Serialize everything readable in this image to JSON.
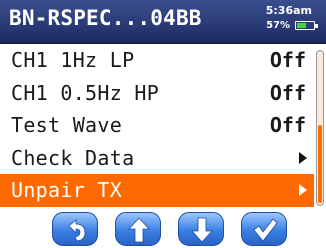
{
  "header": {
    "title": "BN-RSPEC...04BB",
    "time": "5:36am",
    "battery_percent": "57%",
    "battery_level": 0.57,
    "battery_color": "#46d23a"
  },
  "menu": {
    "items": [
      {
        "label": "CH1 1Hz LP",
        "value": "Off"
      },
      {
        "label": "CH1 0.5Hz HP",
        "value": "Off"
      },
      {
        "label": "Test Wave",
        "value": "Off"
      },
      {
        "label": "Check Data"
      },
      {
        "label": "Unpair TX"
      }
    ],
    "selected_index": 4,
    "highlight_color": "#ff6a00"
  },
  "softkeys": [
    {
      "icon": "back-arrow-icon"
    },
    {
      "icon": "up-arrow-icon"
    },
    {
      "icon": "down-arrow-icon"
    },
    {
      "icon": "checkmark-icon"
    }
  ]
}
